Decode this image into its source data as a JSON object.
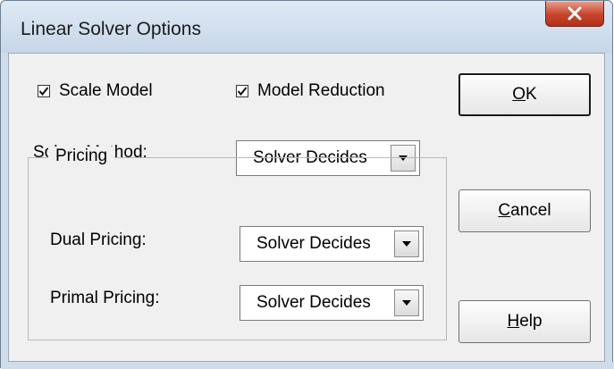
{
  "window": {
    "title": "Linear Solver Options",
    "close_icon": "close-x-icon"
  },
  "options": {
    "scale_model": {
      "label": "Scale Model",
      "checked": true
    },
    "model_reduction": {
      "label": "Model Reduction",
      "checked": true
    }
  },
  "solver_method": {
    "label": "Solver Method:",
    "value": "Solver Decides"
  },
  "pricing": {
    "legend": "Pricing",
    "dual": {
      "label": "Dual Pricing:",
      "value": "Solver Decides"
    },
    "primal": {
      "label": "Primal Pricing:",
      "value": "Solver Decides"
    }
  },
  "buttons": {
    "ok": {
      "mnemonic": "O",
      "rest": "K"
    },
    "cancel": {
      "mnemonic": "C",
      "rest": "ancel"
    },
    "help": {
      "mnemonic": "H",
      "rest": "elp"
    }
  }
}
